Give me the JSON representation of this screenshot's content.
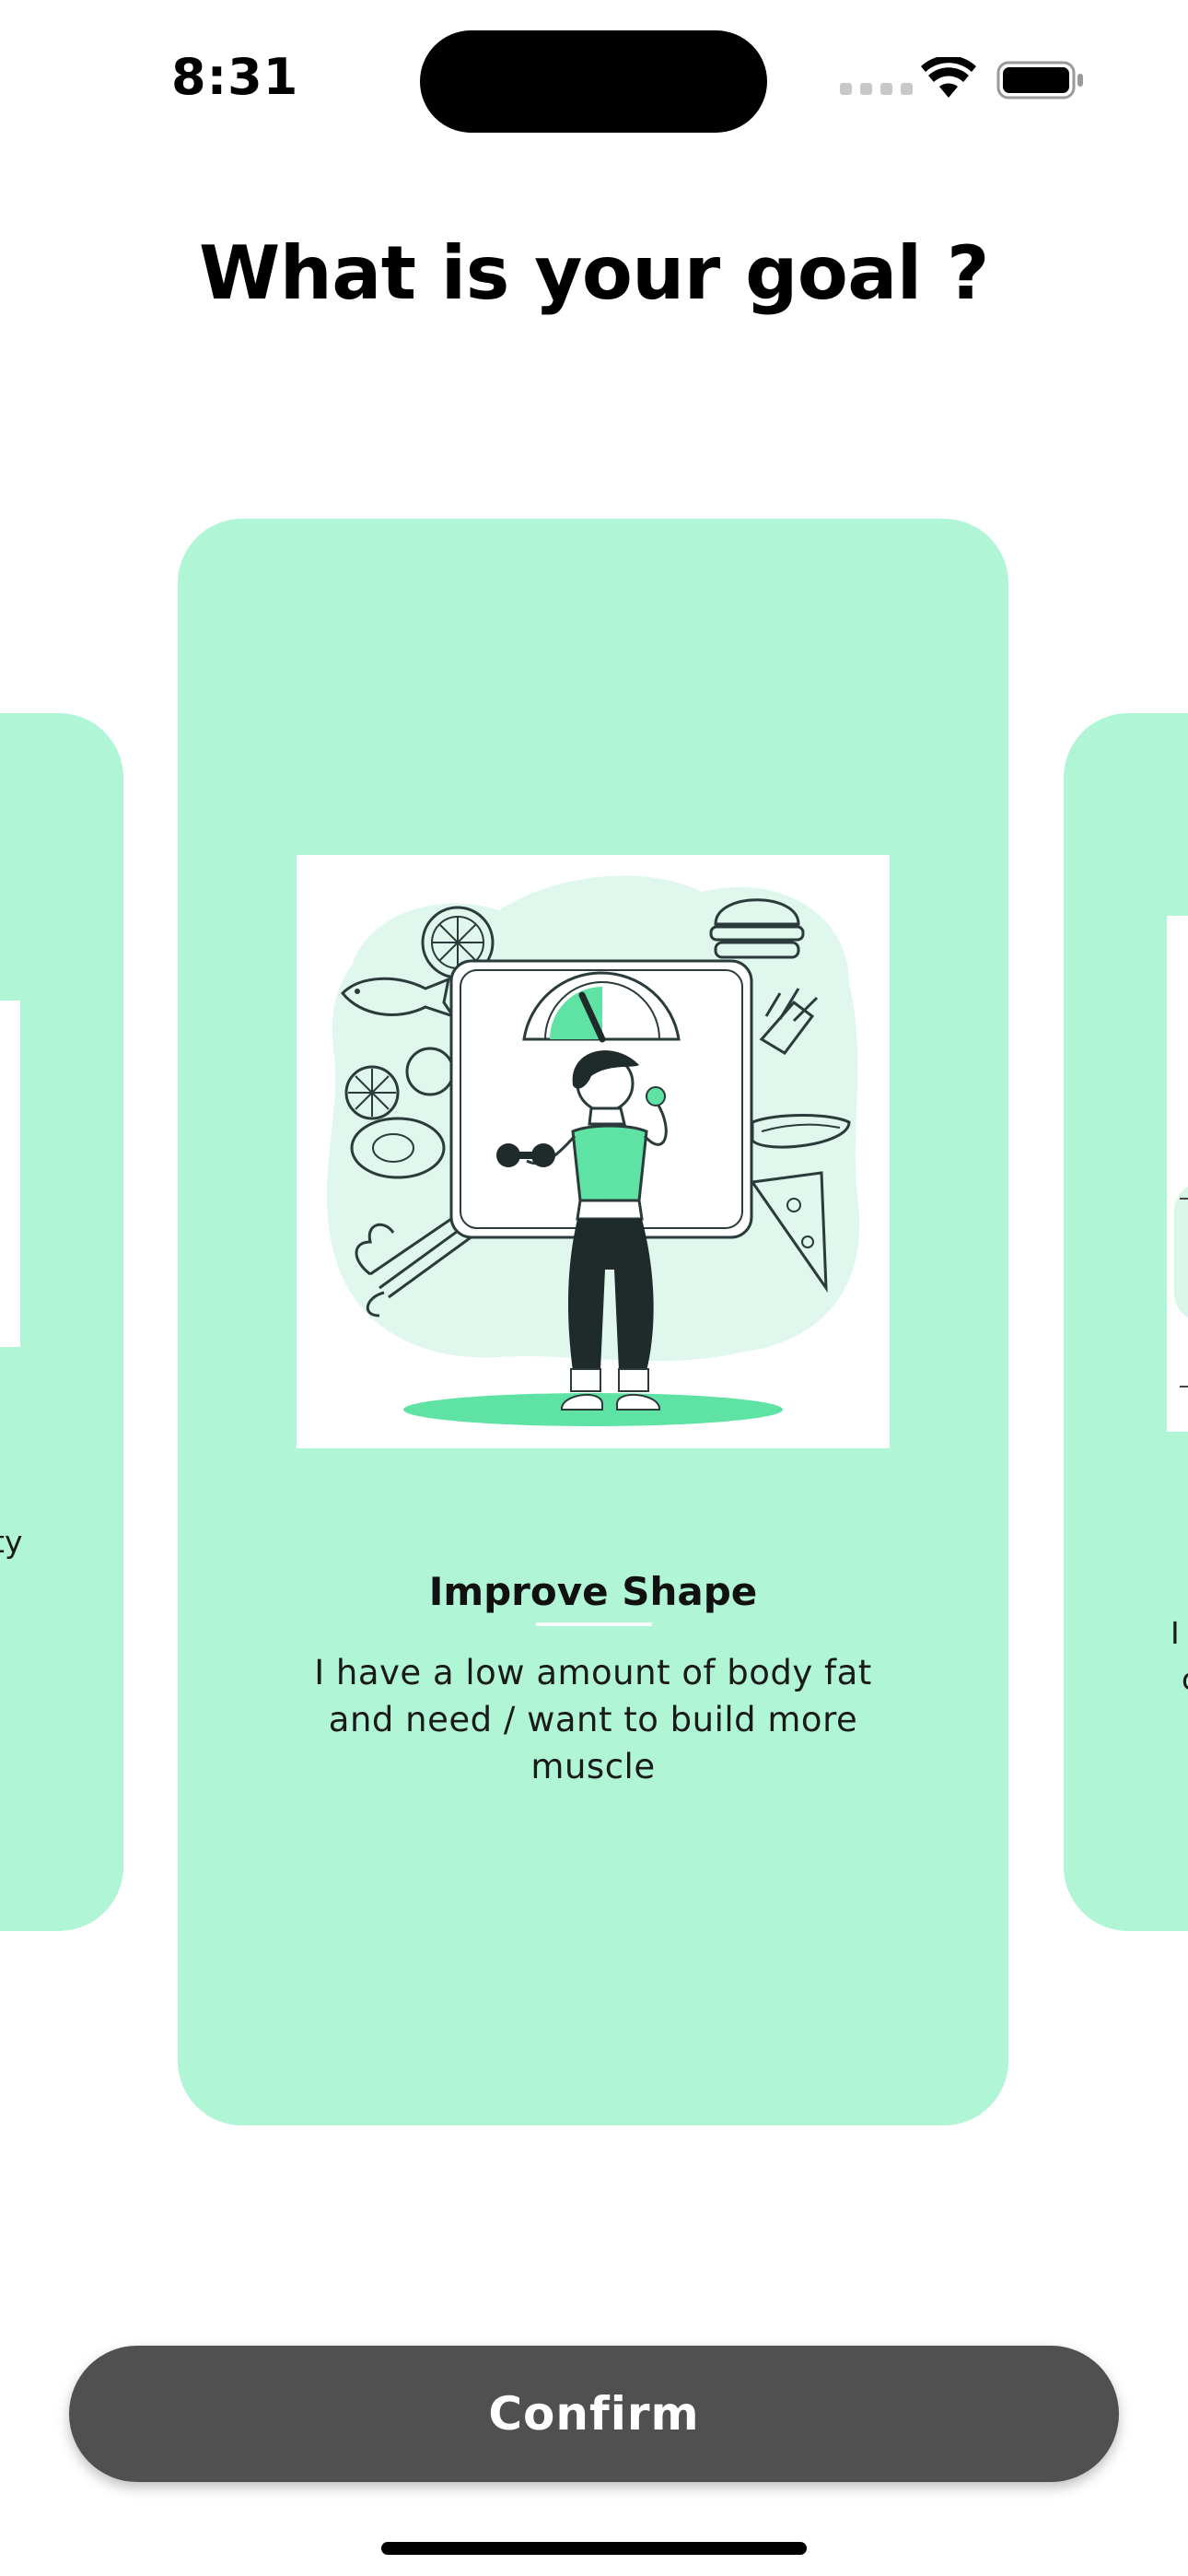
{
  "status_bar": {
    "time": "8:31",
    "icons": [
      "cellular-signal-icon",
      "wifi-icon",
      "battery-icon"
    ]
  },
  "header": {
    "title": "What is your goal ?"
  },
  "carousel": {
    "left_card": {
      "text_fragment": "ty"
    },
    "center_card": {
      "title": "Improve Shape",
      "description": "I have a low amount of body fat and need / want to build more muscle",
      "illustration": "woman-on-scale-with-dumbbell-illustration"
    },
    "right_card": {
      "text_fragment_line1": "I",
      "text_fragment_line2": "c"
    }
  },
  "footer": {
    "confirm_label": "Confirm"
  },
  "colors": {
    "card_background": "#aff5d6",
    "accent_green": "#5fe3a4",
    "button_background": "#505050",
    "dark_figure": "#1f2a2a"
  }
}
